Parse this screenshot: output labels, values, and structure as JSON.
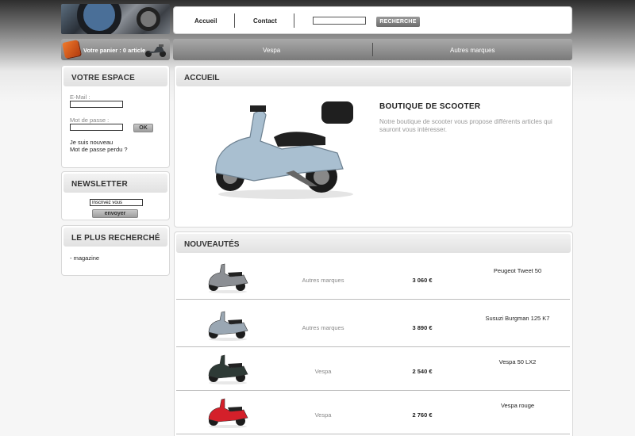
{
  "header": {
    "nav": [
      "Accueil",
      "Contact"
    ],
    "search": {
      "value": "",
      "button": "RECHERCHE"
    }
  },
  "cart": {
    "text": "Votre panier : 0 article"
  },
  "categories": [
    "Vespa",
    "Autres marques"
  ],
  "sidebar": {
    "account": {
      "title": "VOTRE ESPACE",
      "email_label": "E-Mail :",
      "password_label": "Mot de passe :",
      "ok": "OK",
      "new_user": "Je suis nouveau",
      "forgot": "Mot de passe perdu ?"
    },
    "newsletter": {
      "title": "NEWSLETTER",
      "input_value": "Inscrivez vous",
      "button": "envoyer"
    },
    "popular": {
      "title": "LE PLUS RECHERCHÉ",
      "items": [
        "- magazine"
      ]
    }
  },
  "main": {
    "home": {
      "title": "ACCUEIL",
      "shop_title": "BOUTIQUE DE SCOOTER",
      "shop_desc": "Notre boutique de scooter vous propose différents articles qui sauront vous intéresser."
    },
    "news": {
      "title": "NOUVEAUTÉS",
      "products": [
        {
          "brand": "Autres marques",
          "price": "3 060 €",
          "name": "Peugeot Tweet 50",
          "color": "#8c8f94"
        },
        {
          "brand": "Autres marques",
          "price": "3 890 €",
          "name": "Susuzi Burgman 125 K7",
          "color": "#9aa7b3"
        },
        {
          "brand": "Vespa",
          "price": "2 540 €",
          "name": "Vespa 50 LX2",
          "color": "#2e3a36"
        },
        {
          "brand": "Vespa",
          "price": "2 760 €",
          "name": "Vespa rouge",
          "color": "#d4202a"
        }
      ]
    }
  }
}
